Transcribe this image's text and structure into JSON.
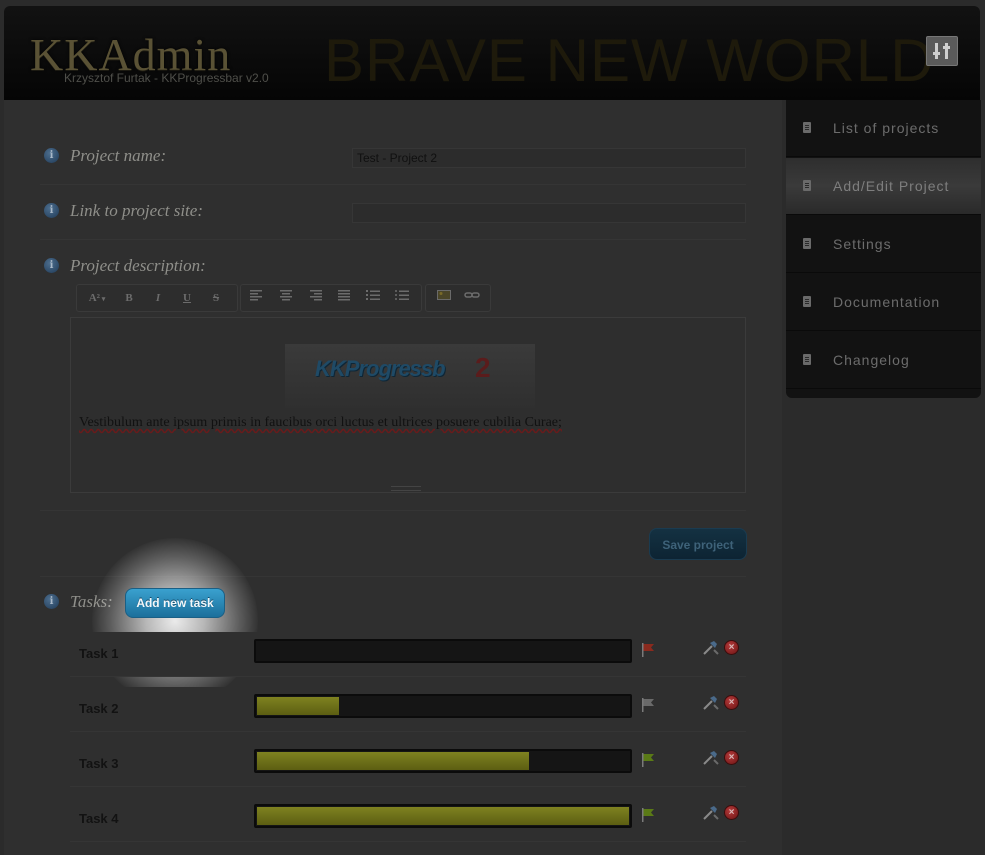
{
  "header": {
    "logo": "KKAdmin",
    "subtitle": "Krzysztof Furtak - KKProgressbar v2.0",
    "tagline": "BRAVE NEW WORLD",
    "settings_icon": "settings-sliders-icon"
  },
  "form": {
    "project_name_label": "Project name:",
    "project_name_value": "Test - Project 2",
    "link_label": "Link to project site:",
    "link_value": "",
    "description_label": "Project description:",
    "info_icon_glyph": "i"
  },
  "toolbar": {
    "font_size": "A²",
    "bold": "B",
    "italic": "I",
    "underline": "U",
    "strike": "S"
  },
  "editor": {
    "image_title": "KKProgressb",
    "image_number": "2",
    "image_caption": "",
    "text": "Vestibulum ante ipsum primis in faucibus orci luctus et ultrices posuere cubilia Curae;"
  },
  "buttons": {
    "save": "Save project",
    "add_task": "Add new task"
  },
  "tasks": {
    "label": "Tasks:",
    "items": [
      {
        "name": "Task 1",
        "progress": 0,
        "flag_color": "#8a2a1e"
      },
      {
        "name": "Task 2",
        "progress": 22,
        "flag_color": "#6a6a6a"
      },
      {
        "name": "Task 3",
        "progress": 73,
        "flag_color": "#5a7a16"
      },
      {
        "name": "Task 4",
        "progress": 100,
        "flag_color": "#5a7a16"
      }
    ]
  },
  "sidebar": {
    "items": [
      {
        "label": "List of projects",
        "active": false
      },
      {
        "label": "Add/Edit Project",
        "active": true
      },
      {
        "label": "Settings",
        "active": false
      },
      {
        "label": "Documentation",
        "active": false
      },
      {
        "label": "Changelog",
        "active": false
      }
    ]
  },
  "colors": {
    "accent": "#1b6f9b",
    "progress_fill": "#7f8220",
    "delete": "#b53a3a"
  }
}
